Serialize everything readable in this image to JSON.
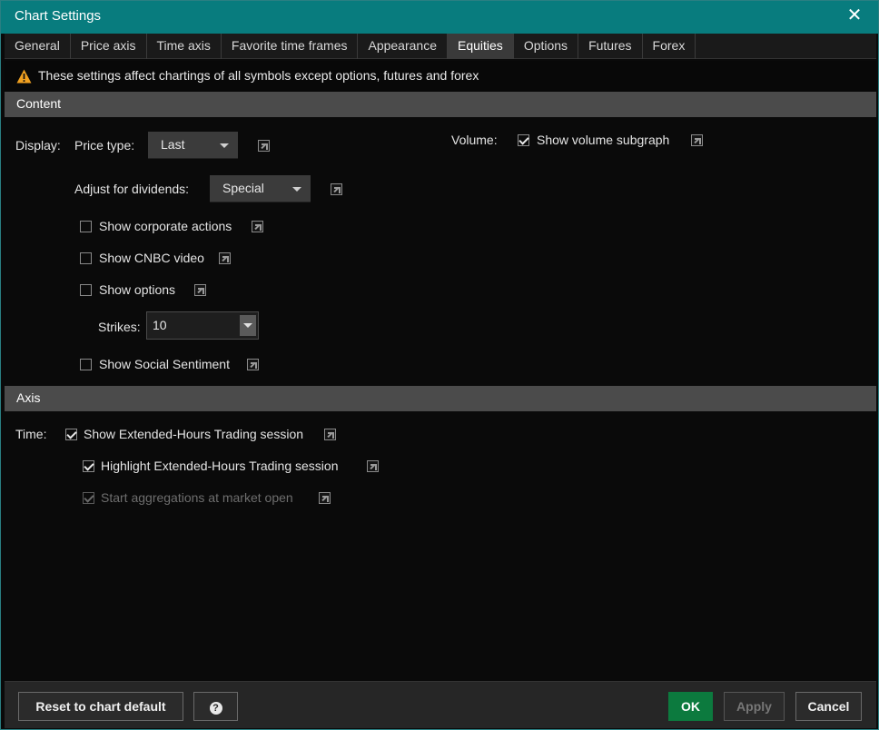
{
  "window": {
    "title": "Chart Settings"
  },
  "tabs": [
    {
      "label": "General"
    },
    {
      "label": "Price axis"
    },
    {
      "label": "Time axis"
    },
    {
      "label": "Favorite time frames"
    },
    {
      "label": "Appearance"
    },
    {
      "label": "Equities",
      "active": true
    },
    {
      "label": "Options"
    },
    {
      "label": "Futures"
    },
    {
      "label": "Forex"
    }
  ],
  "warning": {
    "text": "These settings affect chartings of all symbols except options, futures and forex",
    "icon": "warning-triangle-icon",
    "color": "#f0a020"
  },
  "content": {
    "header": "Content",
    "display_label": "Display:",
    "price_type_label": "Price type:",
    "price_type_value": "Last",
    "adjust_label": "Adjust for dividends:",
    "adjust_value": "Special",
    "volume_label": "Volume:",
    "show_volume": {
      "label": "Show volume subgraph",
      "checked": true
    },
    "show_corporate": {
      "label": "Show corporate actions",
      "checked": false
    },
    "show_cnbc": {
      "label": "Show CNBC video",
      "checked": false
    },
    "show_options": {
      "label": "Show options",
      "checked": false
    },
    "strikes_label": "Strikes:",
    "strikes_value": "10",
    "show_social": {
      "label": "Show Social Sentiment",
      "checked": false
    }
  },
  "axis": {
    "header": "Axis",
    "time_label": "Time:",
    "show_ext": {
      "label": "Show Extended-Hours Trading session",
      "checked": true
    },
    "highlight_ext": {
      "label": "Highlight Extended-Hours Trading session",
      "checked": true
    },
    "start_agg": {
      "label": "Start aggregations at market open",
      "checked": true,
      "disabled": true
    }
  },
  "footer": {
    "reset_label": "Reset to chart default",
    "help_label": "?",
    "ok_label": "OK",
    "apply_label": "Apply",
    "cancel_label": "Cancel"
  },
  "colors": {
    "titlebar": "#087c7e",
    "ok": "#0c7a3e",
    "section": "#4b4b4b"
  }
}
